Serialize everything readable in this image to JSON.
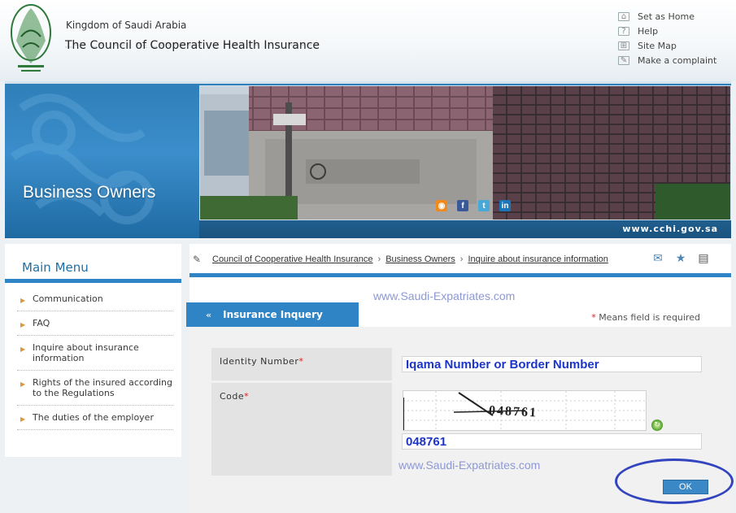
{
  "header": {
    "kingdom": "Kingdom of Saudi Arabia",
    "council": "The Council of Cooperative Health Insurance",
    "links": [
      {
        "label": "Set as Home",
        "icon": "home-icon"
      },
      {
        "label": "Help",
        "icon": "help-icon"
      },
      {
        "label": "Site Map",
        "icon": "sitemap-icon"
      },
      {
        "label": "Make a complaint",
        "icon": "complaint-icon"
      }
    ]
  },
  "banner": {
    "title": "Business Owners",
    "url": "www.cchi.gov.sa",
    "social": [
      {
        "label": "rss",
        "color": "#f08a1c"
      },
      {
        "label": "f",
        "color": "#3b5998"
      },
      {
        "label": "t",
        "color": "#4aa8d8"
      },
      {
        "label": "in",
        "color": "#1c75b9"
      }
    ]
  },
  "sidebar": {
    "title": "Main Menu",
    "items": [
      {
        "label": "Communication"
      },
      {
        "label": "FAQ"
      },
      {
        "label": "Inquire about insurance information"
      },
      {
        "label": "Rights of the insured according to the Regulations"
      },
      {
        "label": "The duties of the employer"
      }
    ]
  },
  "breadcrumb": [
    "Council of Cooperative Health Insurance",
    "Business Owners",
    "Inquire about insurance information"
  ],
  "watermark": "www.Saudi-Expatriates.com",
  "form": {
    "tab_title": "Insurance Inquery",
    "required_note": "Means field is required",
    "identity_label": "Identity Number",
    "identity_value": "Iqama Number or Border Number",
    "code_label": "Code",
    "captcha_text": "048761",
    "code_value": "048761",
    "ok_label": "OK"
  },
  "colors": {
    "accent": "#2e84c4",
    "watermark": "#8d98d4",
    "highlight_ring": "#3344bf"
  }
}
